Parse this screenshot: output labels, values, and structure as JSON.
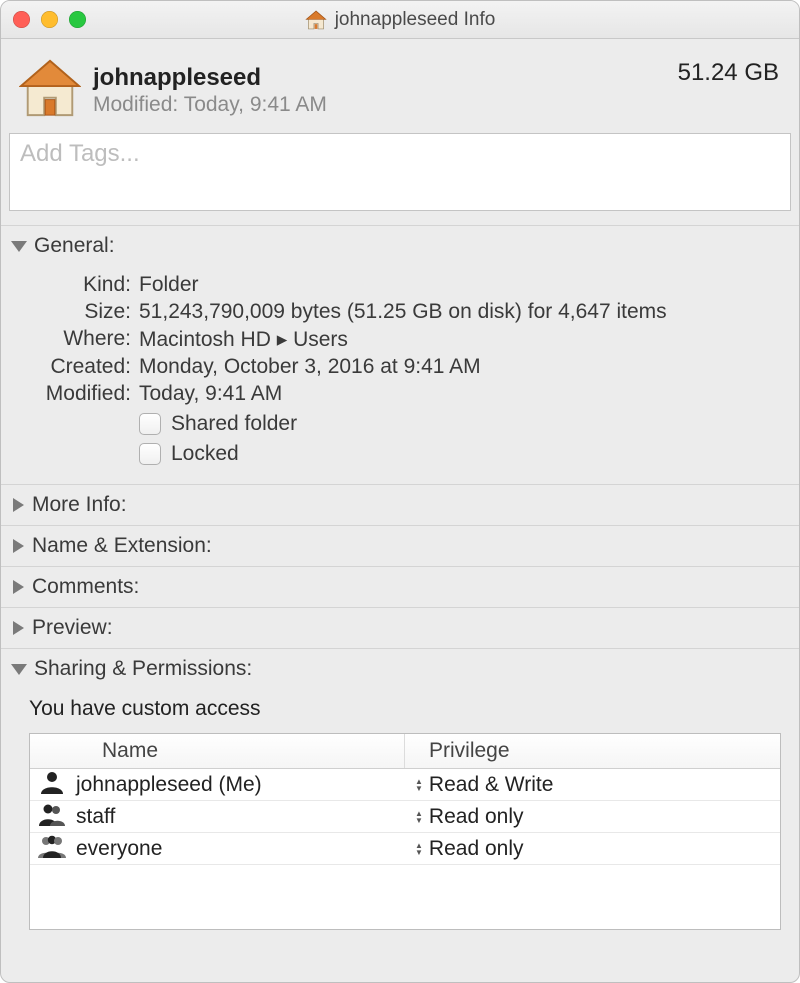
{
  "window": {
    "title": "johnappleseed Info"
  },
  "header": {
    "name": "johnappleseed",
    "modified_label": "Modified:",
    "modified_value": "Today, 9:41 AM",
    "size": "51.24 GB"
  },
  "tags": {
    "placeholder": "Add Tags..."
  },
  "sections": {
    "general_label": "General:",
    "more_info_label": "More Info:",
    "name_ext_label": "Name & Extension:",
    "comments_label": "Comments:",
    "preview_label": "Preview:",
    "sharing_label": "Sharing & Permissions:"
  },
  "general": {
    "kind_label": "Kind:",
    "kind_value": "Folder",
    "size_label": "Size:",
    "size_value": "51,243,790,009 bytes (51.25 GB on disk) for 4,647 items",
    "where_label": "Where:",
    "where_value": "Macintosh HD ▸ Users",
    "created_label": "Created:",
    "created_value": "Monday, October 3, 2016 at 9:41 AM",
    "modified_label": "Modified:",
    "modified_value": "Today, 9:41 AM",
    "shared_folder_label": "Shared folder",
    "locked_label": "Locked"
  },
  "sharing": {
    "access_text": "You have custom access",
    "name_header": "Name",
    "priv_header": "Privilege",
    "rows": [
      {
        "icon": "person",
        "name": "johnappleseed (Me)",
        "priv": "Read & Write"
      },
      {
        "icon": "group",
        "name": "staff",
        "priv": "Read only"
      },
      {
        "icon": "crowd",
        "name": "everyone",
        "priv": "Read only"
      }
    ]
  }
}
